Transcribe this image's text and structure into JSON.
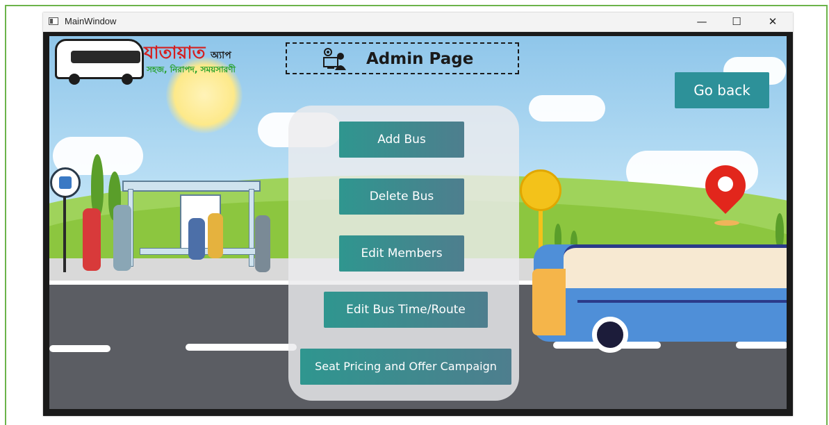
{
  "window": {
    "title": "MainWindow",
    "controls": {
      "minimize": "—",
      "maximize": "☐",
      "close": "✕"
    }
  },
  "logo": {
    "name": "যাতায়াত",
    "suffix": "অ্যাপ",
    "tagline": "সহজ, নিরাপদ, সময়সারণী"
  },
  "header": {
    "title": "Admin Page",
    "icon": "admin-gear-person-icon"
  },
  "go_back": {
    "label": "Go back"
  },
  "menu": {
    "buttons": [
      {
        "label": "Add Bus"
      },
      {
        "label": "Delete Bus"
      },
      {
        "label": "Edit Members"
      },
      {
        "label": "Edit Bus Time/Route"
      },
      {
        "label": "Seat Pricing and Offer Campaign"
      }
    ]
  },
  "background": {
    "bus_stop_sign": "BUS STOP"
  },
  "colors": {
    "button_teal": "#2f968f",
    "button_slate": "#4e7e8e",
    "go_back": "#2d9199",
    "logo_red": "#d41f1f",
    "logo_green": "#27a02b",
    "frame_green": "#6cb34a"
  }
}
